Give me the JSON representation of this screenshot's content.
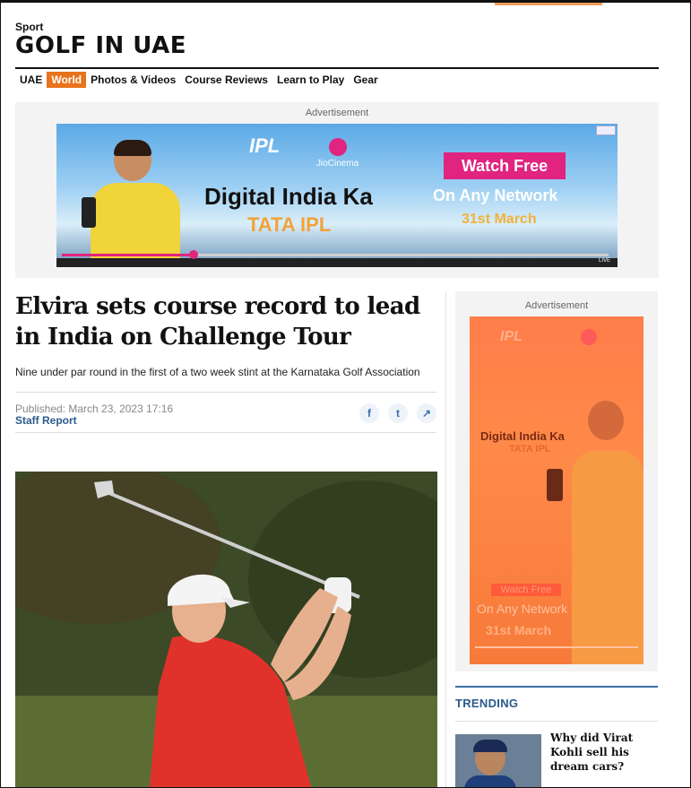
{
  "header": {
    "section_label": "Sport",
    "site_title": "GOLF IN UAE"
  },
  "nav": {
    "items": [
      "UAE",
      "World",
      "Photos & Videos",
      "Course Reviews",
      "Learn to Play",
      "Gear"
    ],
    "active": "World"
  },
  "top_ad": {
    "label": "Advertisement",
    "ipl": "IPL",
    "jiocinema": "JioCinema",
    "headline_1": "Digital India Ka",
    "headline_2": "TATA IPL",
    "watch": "Watch Free",
    "network": "On Any Network",
    "date": "31st March",
    "live": "LIVE"
  },
  "article": {
    "headline": "Elvira sets course record to lead in India on Challenge Tour",
    "subhead": "Nine under par round in the first of a two week stint at the Karnataka Golf Association",
    "published": "Published:  March 23, 2023 17:16",
    "author": "Staff Report",
    "share": {
      "facebook": "f",
      "twitter": "t",
      "share": "↗"
    }
  },
  "side_ad": {
    "label": "Advertisement",
    "ipl": "IPL",
    "headline_1": "Digital India Ka",
    "headline_2": "TATA IPL",
    "watch": "Watch Free",
    "network": "On Any Network",
    "date": "31st March"
  },
  "trending": {
    "title": "TRENDING",
    "items": [
      {
        "title": "Why did Virat Kohli sell his dream cars?"
      }
    ]
  },
  "colors": {
    "accent": "#e8731c",
    "link": "#2a5a8c"
  }
}
